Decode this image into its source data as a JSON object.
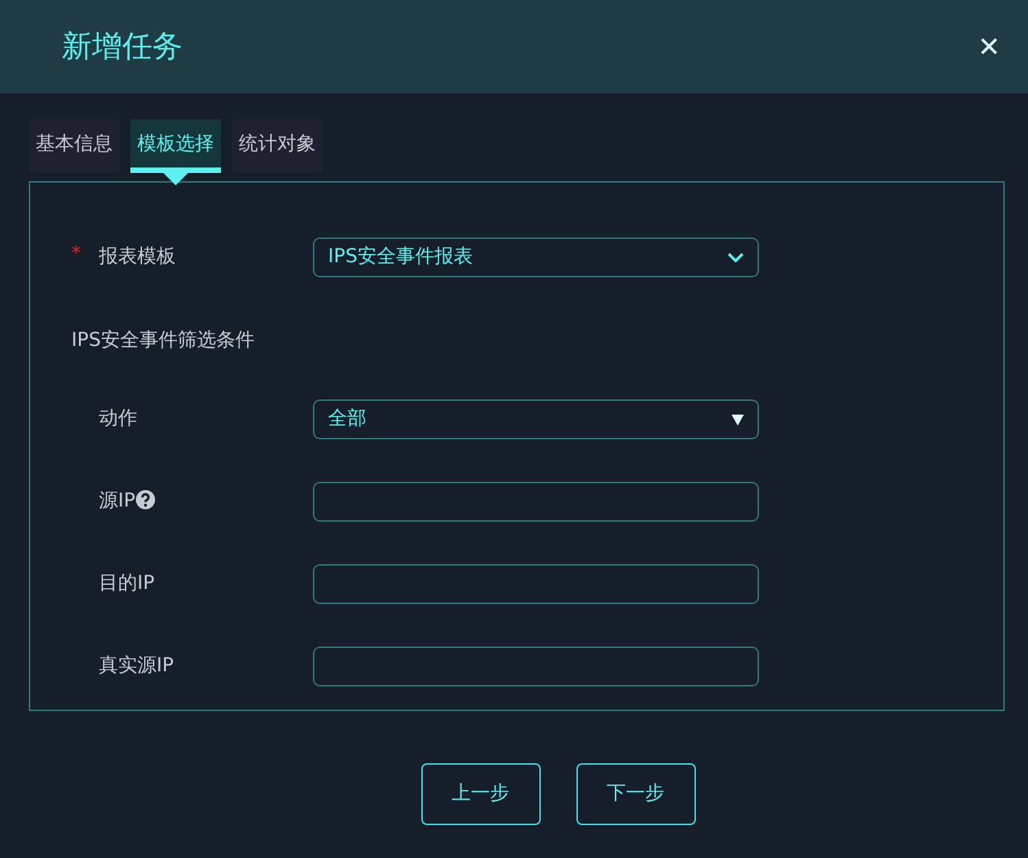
{
  "dialog": {
    "title": "新增任务",
    "close": "✕"
  },
  "tabs": [
    {
      "label": "基本信息",
      "selected": false
    },
    {
      "label": "模板选择",
      "selected": true
    },
    {
      "label": "统计对象",
      "selected": false
    }
  ],
  "template_field": {
    "label": "报表模板",
    "required_mark": "*",
    "kind": "select-chevron",
    "value": "IPS安全事件报表"
  },
  "filter_section": {
    "title": "IPS安全事件筛选条件",
    "fields": [
      {
        "label": "动作",
        "kind": "select-caret",
        "value": "全部"
      },
      {
        "label": "源IP",
        "kind": "text",
        "help": true
      },
      {
        "label": "目的IP",
        "kind": "text"
      },
      {
        "label": "真实源IP",
        "kind": "text"
      }
    ]
  },
  "buttons": [
    {
      "label": "上一步"
    },
    {
      "label": "下一步"
    }
  ]
}
